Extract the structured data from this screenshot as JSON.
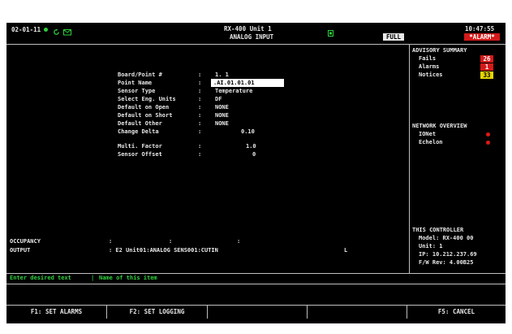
{
  "header": {
    "date": "02-01-11",
    "title_line1": "RX-400 Unit 1",
    "title_line2": "ANALOG INPUT",
    "mode_badge": "FULL",
    "time": "10:47:55",
    "alarm_badge": "*ALARM*",
    "icons": [
      "status-dot-icon",
      "refresh-icon",
      "mail-icon",
      "network-status-icon"
    ]
  },
  "form": {
    "fields": [
      {
        "label": "Board/Point #",
        "sep": ":",
        "value": "1. 1"
      },
      {
        "label": "Point Name",
        "sep": ":",
        "value": ".AI.01.01.01"
      },
      {
        "label": "Sensor Type",
        "sep": ":",
        "value": "Temperature"
      },
      {
        "label": "Select Eng. Units",
        "sep": ":",
        "value": "DF"
      },
      {
        "label": "Default on Open",
        "sep": ":",
        "value": "NONE"
      },
      {
        "label": "Default on Short",
        "sep": ":",
        "value": "NONE"
      },
      {
        "label": "Default Other",
        "sep": ":",
        "value": "NONE"
      },
      {
        "label": "Change Delta",
        "sep": ":",
        "value": "0.10"
      },
      {
        "label": "Multi. Factor",
        "sep": ":",
        "value": "1.0"
      },
      {
        "label": "Sensor Offset",
        "sep": ":",
        "value": "0"
      }
    ]
  },
  "bottom": {
    "occupancy_label": "OCCUPANCY",
    "occupancy_sep1": ":",
    "occupancy_sep2": ":",
    "occupancy_sep3": ":",
    "output_label": "OUTPUT",
    "output_value": ": E2 Unit01:ANALOG SENS001:CUTIN",
    "output_flag": "L"
  },
  "advisory": {
    "title": "ADVISORY SUMMARY",
    "items": [
      {
        "label": "Fails",
        "count": "26",
        "color": "#d41a1a"
      },
      {
        "label": "Alarms",
        "count": "1",
        "color": "#d41a1a"
      },
      {
        "label": "Notices",
        "count": "33",
        "color": "#e6d400"
      }
    ]
  },
  "network": {
    "title": "NETWORK OVERVIEW",
    "items": [
      {
        "label": "IONet",
        "status_color": "#e01818"
      },
      {
        "label": "Echelon",
        "status_color": "#e01818"
      }
    ]
  },
  "controller": {
    "title": "THIS CONTROLLER",
    "model": "Model: RX-400  00",
    "unit": "Unit: 1",
    "ip": "IP: 10.212.237.69",
    "fw": "F/W Rev: 4.00B25"
  },
  "status_bar": {
    "prompt": "Enter desired text",
    "divider": "|",
    "hint": "Name of this item"
  },
  "function_keys": [
    {
      "label": "F1: SET ALARMS"
    },
    {
      "label": "F2: SET LOGGING"
    },
    {
      "label": ""
    },
    {
      "label": ""
    },
    {
      "label": "F5: CANCEL"
    }
  ],
  "colors": {
    "screen_bg": "#000000",
    "text": "#e8e8e8",
    "status_green": "#2ed03c",
    "badge_yellow": "#e6d400",
    "alarm_red": "#d41a1a",
    "lines": "#bfbfbf"
  }
}
